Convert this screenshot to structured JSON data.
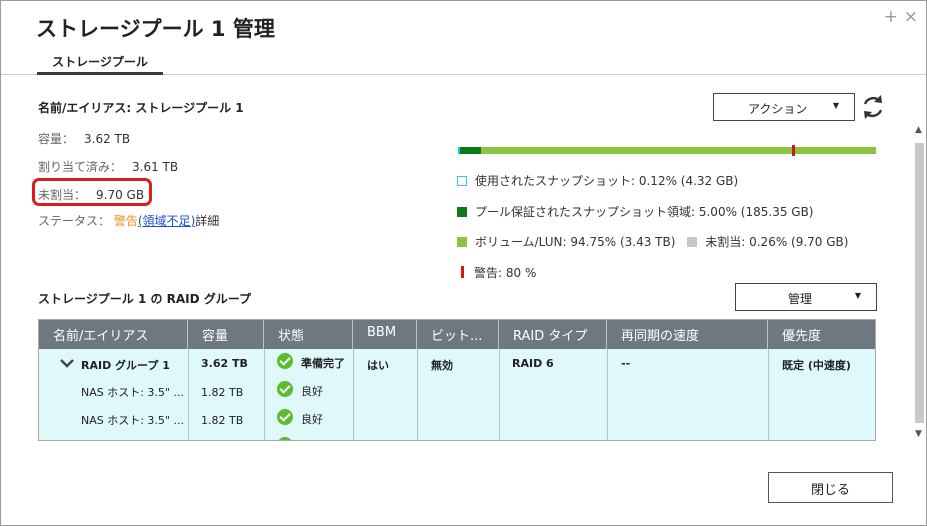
{
  "window": {
    "title": "ストレージプール 1 管理",
    "plus_icon": "+",
    "close_icon": "×"
  },
  "tabs": [
    {
      "label": "ストレージプール"
    }
  ],
  "info": {
    "name_line": "名前/エイリアス: ストレージプール 1",
    "capacity_label": "容量：",
    "capacity_value": "3.62 TB",
    "allocated_label": "割り当て済み：",
    "allocated_value": "3.61 TB",
    "unallocated_label": "未割当：",
    "unallocated_value": "9.70 GB",
    "status_label": "ステータス：",
    "status_warning": "警告",
    "status_paren_open": "(",
    "status_link": "領域不足",
    "status_paren_close": ")",
    "status_detail": "詳細"
  },
  "actions": {
    "action_label": "アクション",
    "manage_label": "管理",
    "close_label": "閉じる"
  },
  "usage": {
    "snapshot_fraction": 0.0012,
    "guaranteed_fraction": 0.05,
    "volume_fraction": 0.9475,
    "free_fraction": 0.0026,
    "warning_fraction": 0.8,
    "legend": {
      "snapshot": "使用されたスナップショット: 0.12% (4.32 GB)",
      "guaranteed": "プール保証されたスナップショット領域: 5.00% (185.35 GB)",
      "volume": "ボリューム/LUN: 94.75% (3.43 TB)",
      "free": "未割当: 0.26% (9.70 GB)",
      "warning": "警告: 80 %"
    },
    "colors": {
      "snapshot": "#00d8d8",
      "guaranteed": "#0a7a1a",
      "volume": "#8bc53f",
      "free": "#c8c8c8",
      "warning": "#d9141c"
    }
  },
  "raid": {
    "title": "ストレージプール 1 の RAID グループ",
    "columns": [
      "名前/エイリアス",
      "容量",
      "状態",
      "BBM",
      "ビット...",
      "RAID タイプ",
      "再同期の速度",
      "優先度"
    ],
    "group": {
      "name": "RAID グループ 1",
      "capacity": "3.62 TB",
      "status": "準備完了",
      "bbm": "はい",
      "bitmap": "無効",
      "raid_type": "RAID 6",
      "resync": "--",
      "priority": "既定 (中速度)"
    },
    "disks": [
      {
        "name": "NAS ホスト: 3.5\" ...",
        "capacity": "1.82 TB",
        "status": "良好"
      },
      {
        "name": "NAS ホスト: 3.5\" ...",
        "capacity": "1.82 TB",
        "status": "良好"
      }
    ]
  },
  "accent_colors": {
    "highlight": "#e01b1b",
    "ok": "#5bbc2e",
    "warning_text": "#f0901e",
    "link": "#1a4fcf",
    "grid_header": "#6d7881",
    "grid_body": "#dff9fb"
  }
}
